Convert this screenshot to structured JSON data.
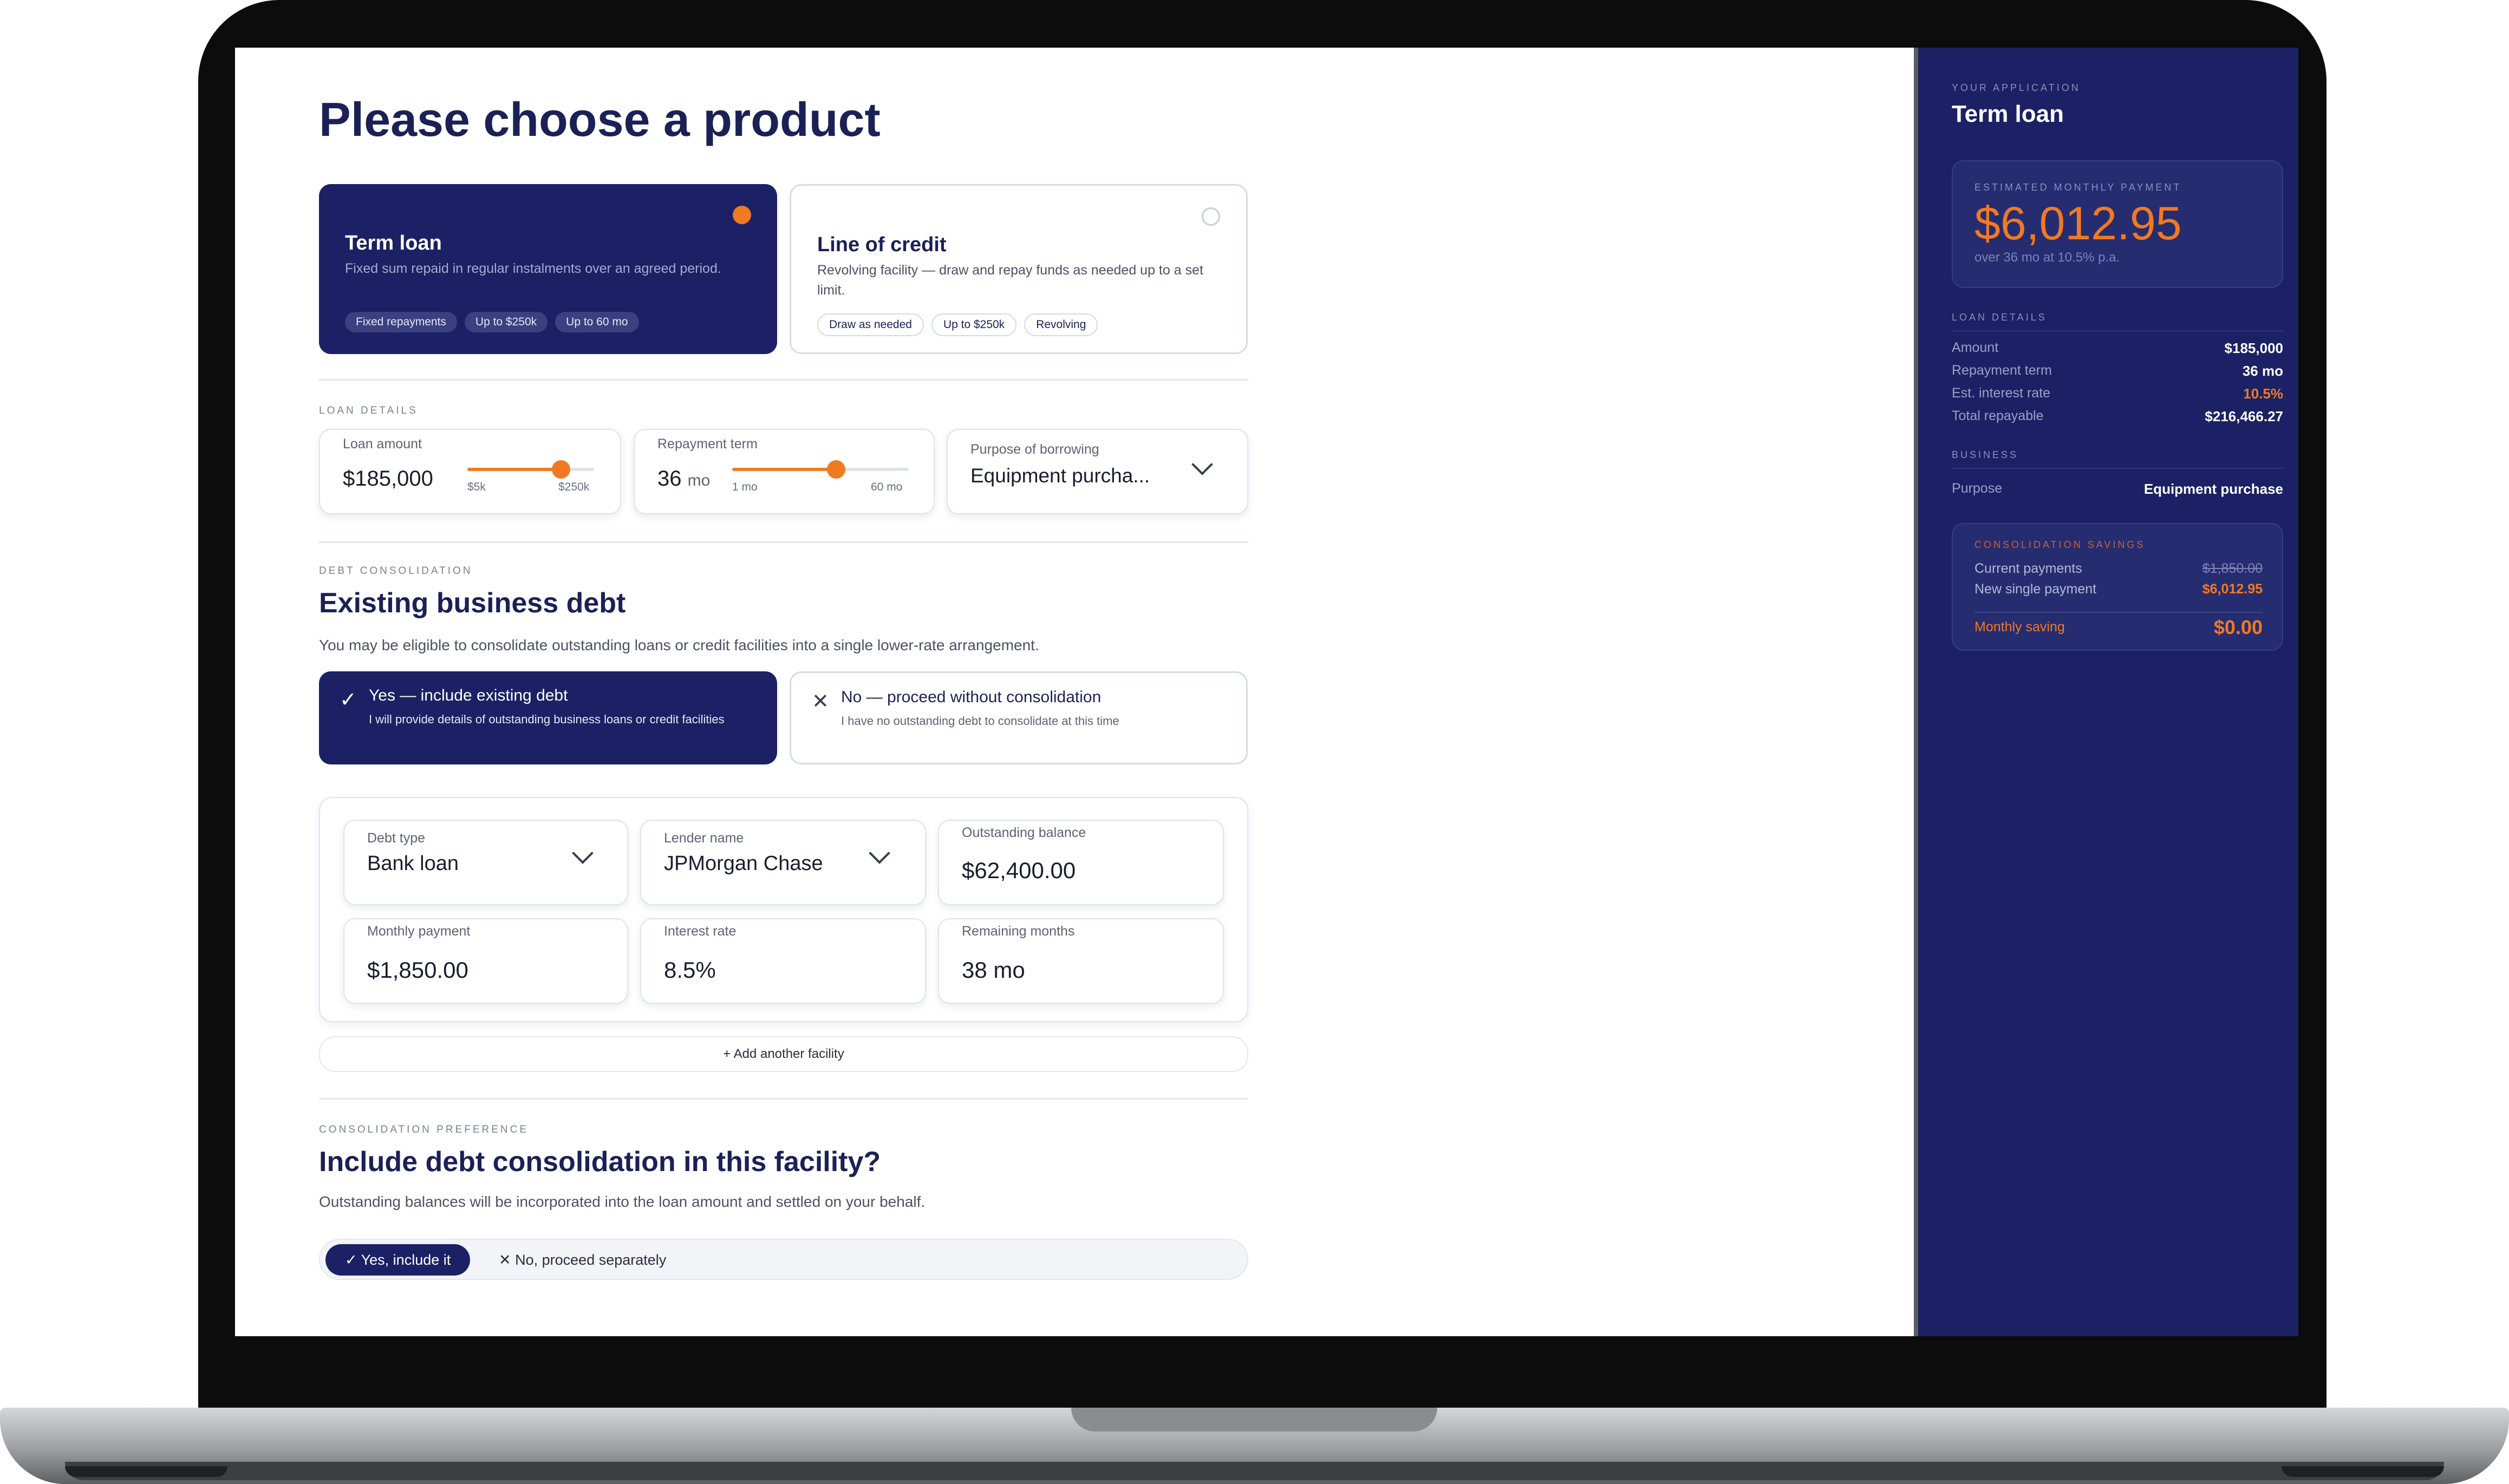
{
  "page": {
    "title": "Please choose a product"
  },
  "products": [
    {
      "title": "Term loan",
      "description": "Fixed sum repaid in regular instalments over an agreed period.",
      "chips": [
        "Fixed repayments",
        "Up to $250k",
        "Up to 60 mo"
      ],
      "selected": true
    },
    {
      "title": "Line of credit",
      "description": "Revolving facility — draw and repay funds as needed up to a set limit.",
      "chips": [
        "Draw as needed",
        "Up to $250k",
        "Revolving"
      ],
      "selected": false
    }
  ],
  "loan_details": {
    "section_label": "LOAN DETAILS",
    "amount": {
      "label": "Loan amount",
      "value": "$185,000",
      "min_label": "$5k",
      "max_label": "$250k",
      "level": 0.74
    },
    "term": {
      "label": "Repayment term",
      "value": "36",
      "unit": "mo",
      "min_label": "1 mo",
      "max_label": "60 mo",
      "level": 0.59
    },
    "purpose": {
      "label": "Purpose of borrowing",
      "value": "Equipment purcha..."
    }
  },
  "debt": {
    "section_label": "DEBT CONSOLIDATION",
    "heading": "Existing business debt",
    "description": "You may be eligible to consolidate outstanding loans or credit facilities into a single lower-rate arrangement.",
    "options": [
      {
        "mark": "✓",
        "title": "Yes — include existing debt",
        "description": "I will provide details of outstanding business loans or credit facilities",
        "selected": true
      },
      {
        "mark": "✕",
        "title": "No — proceed without consolidation",
        "description": "I have no outstanding debt to consolidate at this time",
        "selected": false
      }
    ],
    "fields": {
      "debt_type": {
        "label": "Debt type",
        "value": "Bank loan"
      },
      "lender_name": {
        "label": "Lender name",
        "value": "JPMorgan Chase"
      },
      "outstanding_balance": {
        "label": "Outstanding balance",
        "value": "$62,400.00"
      },
      "monthly_payment": {
        "label": "Monthly payment",
        "value": "$1,850.00"
      },
      "interest_rate": {
        "label": "Interest rate",
        "value": "8.5%"
      },
      "remaining_months": {
        "label": "Remaining months",
        "value": "38 mo"
      }
    },
    "add_facility_label": "+ Add another facility"
  },
  "preference": {
    "section_label": "CONSOLIDATION PREFERENCE",
    "heading": "Include debt consolidation in this facility?",
    "description": "Outstanding balances will be incorporated into the loan amount and settled on your behalf.",
    "yes_label": "✓ Yes, include it",
    "no_label": "✕ No, proceed separately"
  },
  "sidebar": {
    "app_label": "YOUR APPLICATION",
    "product": "Term loan",
    "payment": {
      "label": "ESTIMATED MONTHLY PAYMENT",
      "amount": "$6,012.95",
      "sub": "over 36 mo at 10.5% p.a."
    },
    "loan_details_label": "LOAN DETAILS",
    "rows": [
      {
        "key": "Amount",
        "value": "$185,000"
      },
      {
        "key": "Repayment term",
        "value": "36 mo"
      },
      {
        "key": "Est. interest rate",
        "value": "10.5%"
      },
      {
        "key": "Total repayable",
        "value": "$216,466.27"
      }
    ],
    "business_label": "BUSINESS",
    "purpose": {
      "key": "Purpose",
      "value": "Equipment purchase"
    },
    "savings": {
      "label": "CONSOLIDATION SAVINGS",
      "current_key": "Current payments",
      "current_value": "$1,850.00",
      "new_key": "New single payment",
      "new_value": "$6,012.95",
      "saving_key": "Monthly saving",
      "saving_value": "$0.00"
    }
  },
  "colors": {
    "navy": "#1b2164",
    "accent_orange": "#f07a22",
    "text_dark": "#1b2156"
  }
}
